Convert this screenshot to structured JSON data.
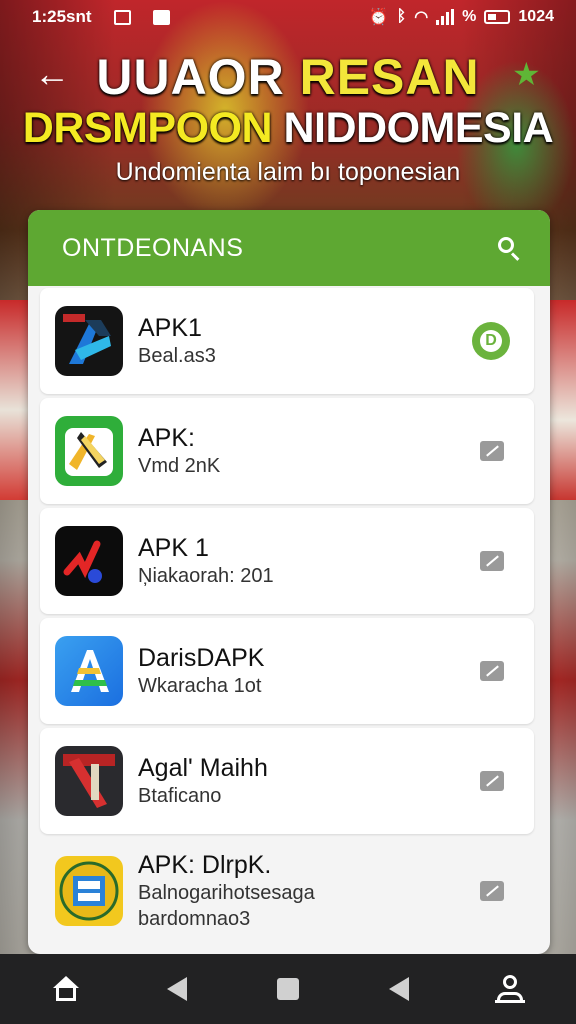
{
  "status_bar": {
    "time": "1:25snt",
    "battery": "1024"
  },
  "header": {
    "title_line1_white": "UUAOR",
    "title_line1_yellow": "RESAN",
    "title_line2_yellow": "DRSMPOON",
    "title_line2_white": "NIDDOMESIA",
    "subtitle": "Undomienta laim bı toponesian"
  },
  "card": {
    "title": "ONTDEONANS"
  },
  "apps": [
    {
      "name": "APK1",
      "meta": "Beal.as3",
      "meta2": "",
      "icon": "app-icon-dark-blue",
      "action": "D"
    },
    {
      "name": "APK:",
      "meta": "Vmd 2nK",
      "meta2": "",
      "icon": "app-icon-green-wing",
      "action": ""
    },
    {
      "name": "APK 1",
      "meta": "Ņiakaorah: 201",
      "meta2": "",
      "icon": "app-icon-black-red",
      "action": ""
    },
    {
      "name": "DarisDAPK",
      "meta": "Wkaracha 1ot",
      "meta2": "",
      "icon": "app-icon-blue-a",
      "action": ""
    },
    {
      "name": "Agal' Maihh",
      "meta": "Btaficano",
      "meta2": "",
      "icon": "app-icon-red-dark",
      "action": ""
    },
    {
      "name": "APK: DlrpK.",
      "meta": "Balnogarihotsesaga",
      "meta2": "bardomnao3",
      "icon": "app-icon-yellow-badge",
      "action": ""
    }
  ],
  "colors": {
    "header_green": "#5ea832",
    "title_yellow": "#f3e63a"
  }
}
